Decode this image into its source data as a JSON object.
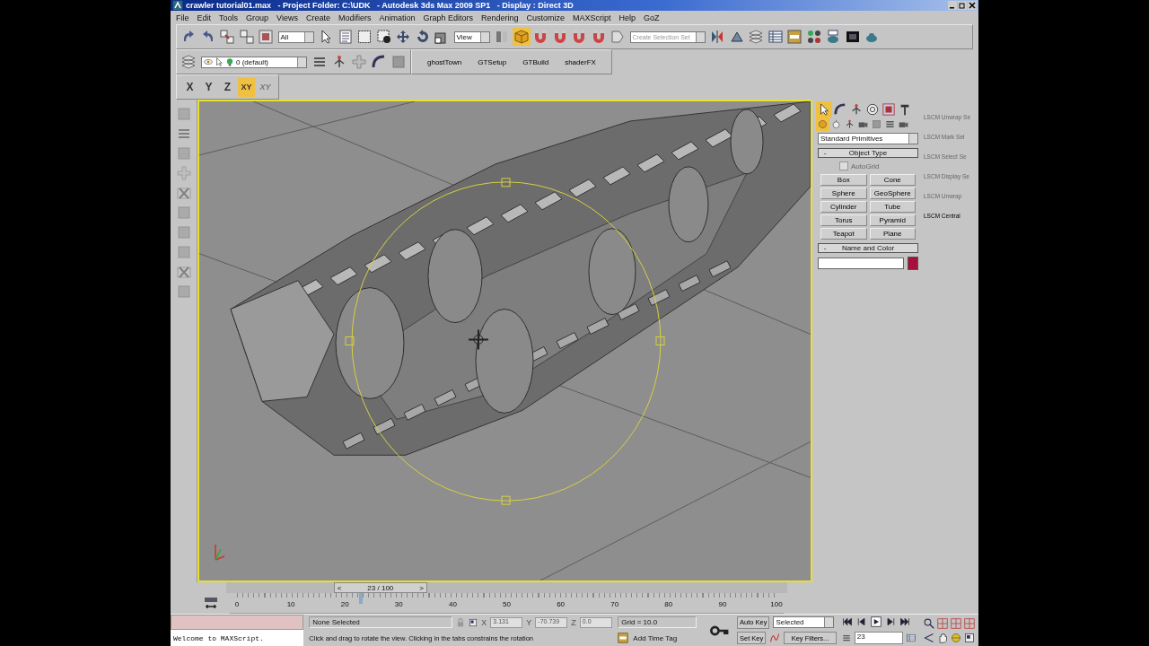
{
  "window": {
    "title": "crawler tutorial01.max   - Project Folder: C:\\UDK   - Autodesk 3ds Max 2009 SP1   - Display : Direct 3D"
  },
  "menu": [
    "File",
    "Edit",
    "Tools",
    "Group",
    "Views",
    "Create",
    "Modifiers",
    "Animation",
    "Graph Editors",
    "Rendering",
    "Customize",
    "MAXScript",
    "Help",
    "GoZ"
  ],
  "main_toolbar": {
    "selection_filter": "All",
    "reference_coordinate_system": "View",
    "named_selection_set": {
      "placeholder": "Create Selection Set"
    }
  },
  "layer_toolbar": {
    "current_layer": "0 (default)",
    "buttons": [
      "ghostTown",
      "GTSetup",
      "GTBuild",
      "shaderFX"
    ]
  },
  "axis_constraints": [
    {
      "label": "X",
      "selected": false
    },
    {
      "label": "Y",
      "selected": false
    },
    {
      "label": "Z",
      "selected": false
    },
    {
      "label": "XY",
      "selected": true
    },
    {
      "label": "XY",
      "selected": false
    }
  ],
  "command_panel": {
    "tabs": [
      {
        "selected": true
      },
      {
        "selected": false
      },
      {
        "selected": false
      },
      {
        "selected": false
      },
      {
        "selected": false
      },
      {
        "selected": false
      }
    ],
    "categories": [
      {
        "selected": true
      },
      {
        "selected": false
      },
      {
        "selected": false
      },
      {
        "selected": false
      },
      {
        "selected": false
      },
      {
        "selected": false
      },
      {
        "selected": false
      }
    ],
    "object_category": "Standard Primitives",
    "object_type": {
      "toggle": "-",
      "title": "Object Type",
      "autogrid": {
        "label": "AutoGrid",
        "checked": false
      },
      "buttons": [
        "Box",
        "Cone",
        "Sphere",
        "GeoSphere",
        "Cylinder",
        "Tube",
        "Torus",
        "Pyramid",
        "Teapot",
        "Plane"
      ]
    },
    "name_and_color": {
      "toggle": "-",
      "title": "Name and Color",
      "color": "#a8103c"
    }
  },
  "macro_panel": [
    {
      "label": "LSCM Unwrap Se",
      "disabled": true
    },
    {
      "label": "LSCM Mark Sel",
      "disabled": true
    },
    {
      "label": "LSCM Select Se",
      "disabled": true
    },
    {
      "label": "LSCM Display Se",
      "disabled": true
    },
    {
      "label": "LSCM Unwrap",
      "disabled": true
    },
    {
      "label": "LSCM Central",
      "disabled": false
    }
  ],
  "time_slider": {
    "label": "23 / 100",
    "prev": "<",
    "next": ">",
    "level": 0.23,
    "ticks": [
      "0",
      "10",
      "20",
      "30",
      "40",
      "50",
      "60",
      "70",
      "80",
      "90",
      "100"
    ]
  },
  "status_bar": {
    "listener_output": "Welcome to MAXScript.",
    "selection": "None Selected",
    "coordinates": [
      {
        "axis": "X",
        "value": "3.131"
      },
      {
        "axis": "Y",
        "value": "-70.739"
      },
      {
        "axis": "Z",
        "value": "0.0"
      }
    ],
    "grid": "Grid = 10.0",
    "prompt": "Click and drag to rotate the view.  Clicking in the tabs constrains the rotation",
    "time_tag": "Add Time Tag",
    "auto_key": "Auto Key",
    "set_key": "Set Key",
    "key_mode": "Selected",
    "key_filters": "Key Filters...",
    "current_frame": "23"
  }
}
